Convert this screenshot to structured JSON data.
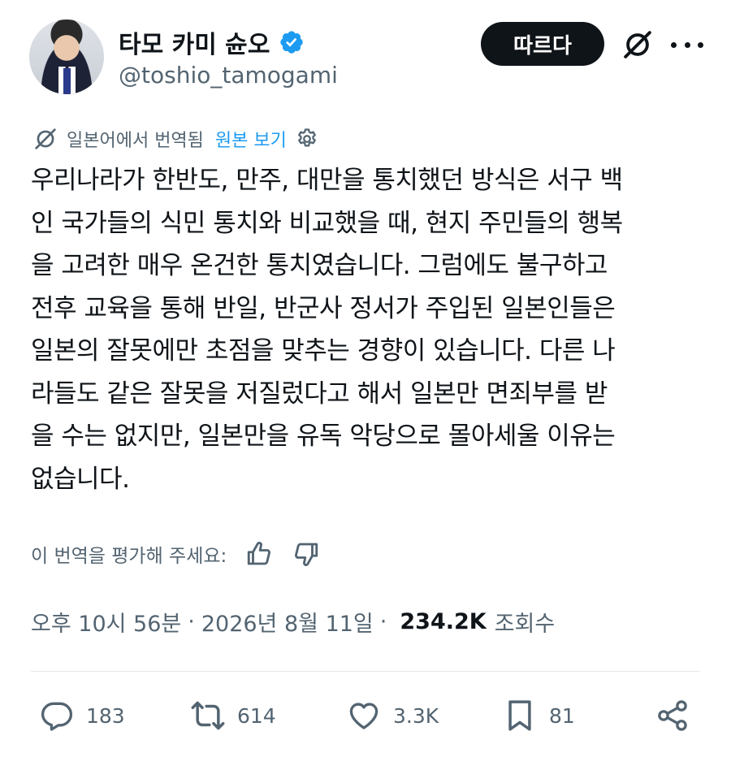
{
  "author": {
    "display_name": "타모 카미 슌오",
    "handle": "@toshio_tamogami",
    "verified": true
  },
  "header": {
    "follow_label": "따르다"
  },
  "translation": {
    "label": "일본어에서 번역됨",
    "view_original": "원본 보기"
  },
  "tweet": {
    "lines": [
      "우리나라가 한반도, 만주, 대만을 통치했던 방식은 서구 백",
      "인 국가들의 식민 통치와 비교했을 때, 현지 주민들의 행복",
      "을 고려한 매우 온건한 통치였습니다. 그럼에도 불구하고",
      "전후 교육을 통해 반일, 반군사 정서가 주입된 일본인들은",
      "일본의 잘못에만 초점을 맞추는 경향이 있습니다. 다른 나",
      "라들도 같은 잘못을 저질렀다고 해서 일본만 면죄부를 받",
      "을 수는 없지만, 일본만을 유독 악당으로 몰아세울 이유는",
      "없습니다."
    ]
  },
  "rating": {
    "label": "이 번역을 평가해 주세요:"
  },
  "meta": {
    "time": "오후 10시 56분",
    "separator": "·",
    "date": "2026년 8월 11일",
    "views": "234.2K",
    "views_label": "조회수"
  },
  "actions": {
    "replies": "183",
    "reposts": "614",
    "likes": "3.3K",
    "bookmarks": "81"
  },
  "colors": {
    "text": "#0f1419",
    "muted": "#536471",
    "link": "#1d9bf0",
    "verified": "#1d9bf0",
    "button": "#0f1419"
  }
}
